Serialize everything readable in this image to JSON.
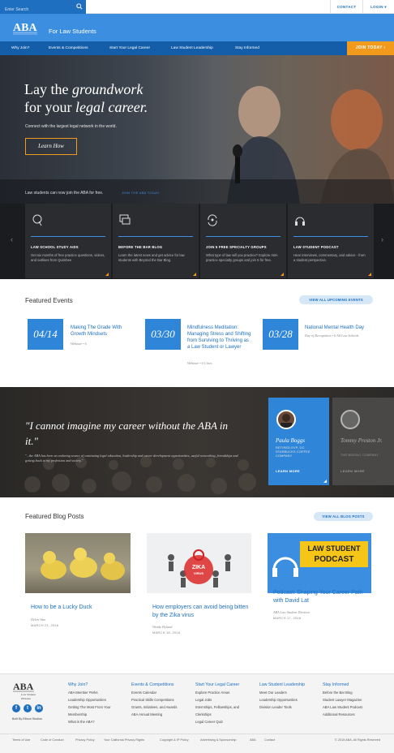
{
  "top": {
    "search_placeholder": "Enter Search",
    "contact": "CONTACT",
    "login": "LOGIN"
  },
  "brand": {
    "title": "For Law Students"
  },
  "nav": {
    "items": [
      "Why Join?",
      "Events & Competitions",
      "Start Your Legal Career",
      "Law Student Leadership",
      "Stay Informed"
    ],
    "join": "JOIN TODAY"
  },
  "hero": {
    "line1": "Lay the ",
    "line1_em": "groundwork",
    "line2": "for your ",
    "line2_em": "legal career.",
    "sub": "Connect with the largest legal network in the world.",
    "cta": "Learn How",
    "free": "Law students can now join the ABA for free.",
    "free_link": "JOIN THE ABA TODAY"
  },
  "tiles": [
    {
      "icon": "q-icon",
      "title": "LAW SCHOOL STUDY AIDS",
      "desc": "Get six months of free practice questions, videos, and outlines from Quimbee"
    },
    {
      "icon": "chat-icon",
      "title": "BEFORE THE BAR BLOG",
      "desc": "Learn the latest news and get advice for law students with Beyond the Bar Blog."
    },
    {
      "icon": "refresh-icon",
      "title": "JOIN 5 FREE SPECIALTY GROUPS",
      "desc": "What type of law will you practice? Explore ABA practice specialty groups and join 5 for free."
    },
    {
      "icon": "headphones-icon",
      "title": "LAW STUDENT PODCAST",
      "desc": "Hear interviews, commentary, and advice - from a student perspective."
    }
  ],
  "events": {
    "heading": "Featured Events",
    "view_all": "VIEW ALL UPCOMING EVENTS",
    "items": [
      {
        "date": "04/14",
        "title": "Making The Grade With Growth Mindsets",
        "meta": "Webinar  •  6"
      },
      {
        "date": "03/30",
        "title": "Mindfulness Meditation: Managing Stress and Shifting from Surviving to Thriving as a Law Student or Lawyer",
        "meta": "Webinar  •  6 Cities"
      },
      {
        "date": "03/28",
        "title": "National Mental Health Day",
        "meta": "Day of Recognition  •  6 All Law Schools"
      }
    ]
  },
  "quote": {
    "text": "\"I cannot imagine my career without the ABA in it.\"",
    "sub": "\"...the ABA has been an enduring source of continuing legal education, leadership and career development opportunities, useful networking, friendships and getting back to my profession and society.\"",
    "people": [
      {
        "name": "Paula Boggs",
        "role": "RETIRED EVP, GC STARBUCKS COFFEE COMPANY",
        "more": "LEARN MORE"
      },
      {
        "name": "Tommy Preston Jr.",
        "role": "THE BOEING COMPANY",
        "more": "LEARN MORE"
      }
    ]
  },
  "blog": {
    "heading": "Featured Blog Posts",
    "view_all": "VIEW ALL BLOG POSTS",
    "zika": "ZIKA",
    "zika_sub": "VIRUS",
    "podcast_line1": "LAW STUDENT",
    "podcast_line2": "PODCAST",
    "posts": [
      {
        "title": "How to be a Lucky Duck",
        "author": "Helen Wan",
        "date": "MARCH 21, 2016"
      },
      {
        "title": "How employers can avoid being bitten by the Zika virus",
        "author": "Wendy Hyland",
        "date": "MARCH 18, 2016"
      },
      {
        "title": "Podcast: Shaping Your Career Path with David Lat",
        "author": "ABA Law Student Division",
        "date": "MARCH 17, 2016"
      }
    ]
  },
  "footer": {
    "logo_sub": "Law Student Division",
    "built_by": "Built By Ellison Studios",
    "columns": [
      {
        "heading": "Why Join?",
        "links": [
          "ABA Member Perks",
          "Leadership Opportunities",
          "Getting The Most From Your",
          "Membership",
          "What is the ABA?"
        ]
      },
      {
        "heading": "Events & Competitions",
        "links": [
          "Events Calendar",
          "Practical Skills Competitions",
          "Grants, Initiatives, and Awards",
          "ABA Annual Meeting"
        ]
      },
      {
        "heading": "Start Your Legal Career",
        "links": [
          "Explore Practice Areas",
          "Legal Jobs",
          "Internships, Fellowships, and",
          "Clerkships",
          "Legal Career Quiz"
        ]
      },
      {
        "heading": "Law Student Leadership",
        "links": [
          "Meet Our Leaders",
          "Leadership Opportunities",
          "Division Leader Tools"
        ]
      },
      {
        "heading": "Stay Informed",
        "links": [
          "Before the Bar Blog",
          "Student Lawyer Magazine",
          "ABA Law Student Podcast",
          "Additional Resources"
        ]
      }
    ],
    "bottom": [
      "Terms of Use",
      "Code of Conduct",
      "Privacy Policy",
      "Your California Privacy Rights",
      "Copyright & IP Policy",
      "Advertising & Sponsorship",
      "ABA",
      "Contact"
    ],
    "copyright": "© 2015 ABA, All Rights Reserved"
  }
}
